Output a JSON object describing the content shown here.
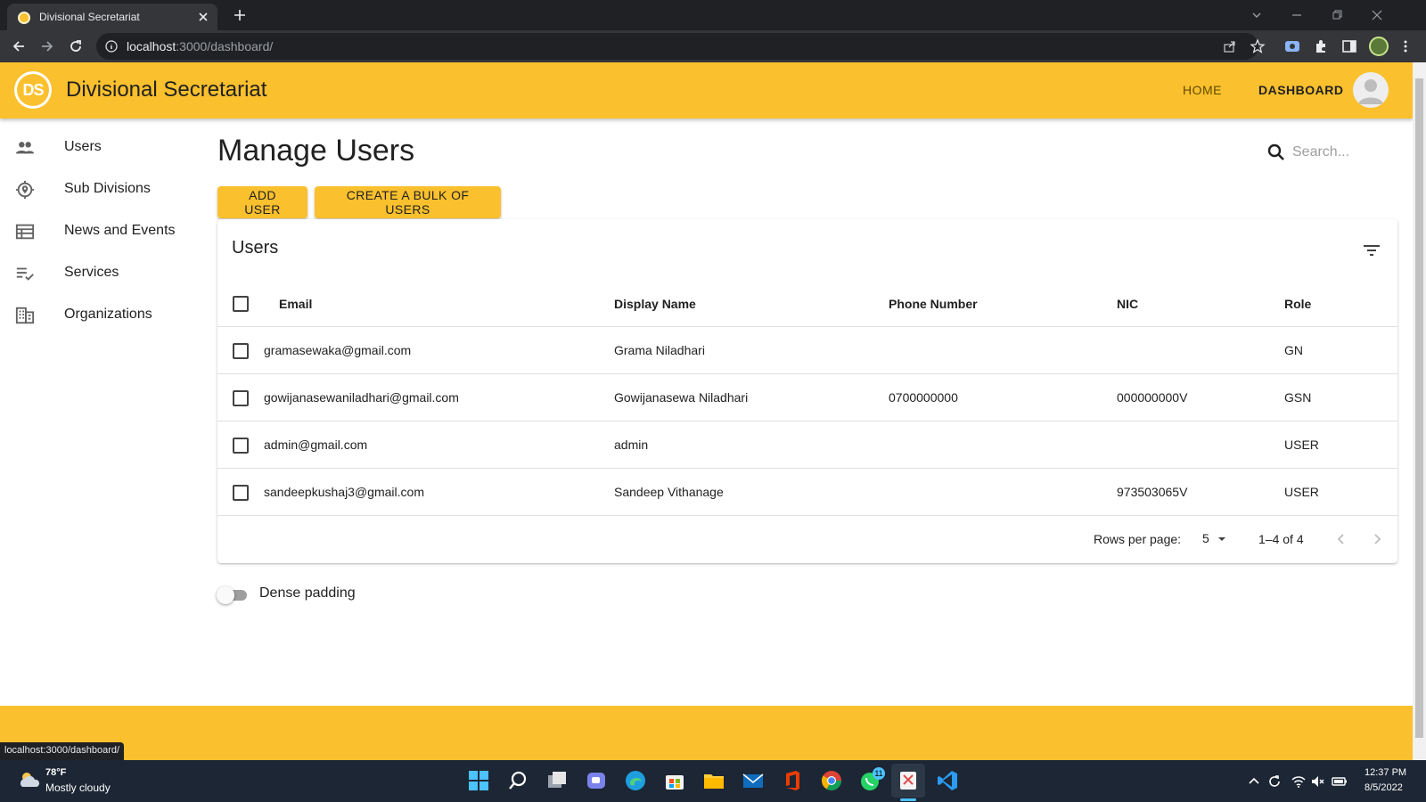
{
  "browser": {
    "tab_title": "Divisional Secretariat",
    "url_host": "localhost",
    "url_path": ":3000/dashboard/",
    "status_url": "localhost:3000/dashboard/"
  },
  "app": {
    "logo_text": "DS",
    "title": "Divisional Secretariat",
    "nav": {
      "home": "HOME",
      "dashboard": "DASHBOARD"
    },
    "accent_color": "#fbc02d"
  },
  "sidebar": {
    "items": [
      {
        "label": "Users",
        "icon": "people-icon"
      },
      {
        "label": "Sub Divisions",
        "icon": "location-icon"
      },
      {
        "label": "News and Events",
        "icon": "calendar-view-icon"
      },
      {
        "label": "Services",
        "icon": "checklist-icon"
      },
      {
        "label": "Organizations",
        "icon": "building-icon"
      }
    ]
  },
  "main": {
    "title": "Manage Users",
    "search_placeholder": "Search...",
    "add_user_label": "ADD USER",
    "bulk_label": "CREATE A BULK OF USERS"
  },
  "table": {
    "title": "Users",
    "columns": [
      "Email",
      "Display Name",
      "Phone Number",
      "NIC",
      "Role"
    ],
    "rows": [
      {
        "email": "gramasewaka@gmail.com",
        "display_name": "Grama Niladhari",
        "phone": "",
        "nic": "",
        "role": "GN"
      },
      {
        "email": "gowijanasewaniladhari@gmail.com",
        "display_name": "Gowijanasewa Niladhari",
        "phone": "0700000000",
        "nic": "000000000V",
        "role": "GSN"
      },
      {
        "email": "admin@gmail.com",
        "display_name": "admin",
        "phone": "",
        "nic": "",
        "role": "USER"
      },
      {
        "email": "sandeepkushaj3@gmail.com",
        "display_name": "Sandeep Vithanage",
        "phone": "",
        "nic": "973503065V",
        "role": "USER"
      }
    ],
    "rows_per_page_label": "Rows per page:",
    "rows_per_page_value": "5",
    "range": "1–4 of 4"
  },
  "dense_padding_label": "Dense padding",
  "dense_padding_on": false,
  "taskbar": {
    "temperature": "78°F",
    "weather": "Mostly cloudy",
    "time": "12:37 PM",
    "date": "8/5/2022",
    "whatsapp_badge": "11"
  }
}
